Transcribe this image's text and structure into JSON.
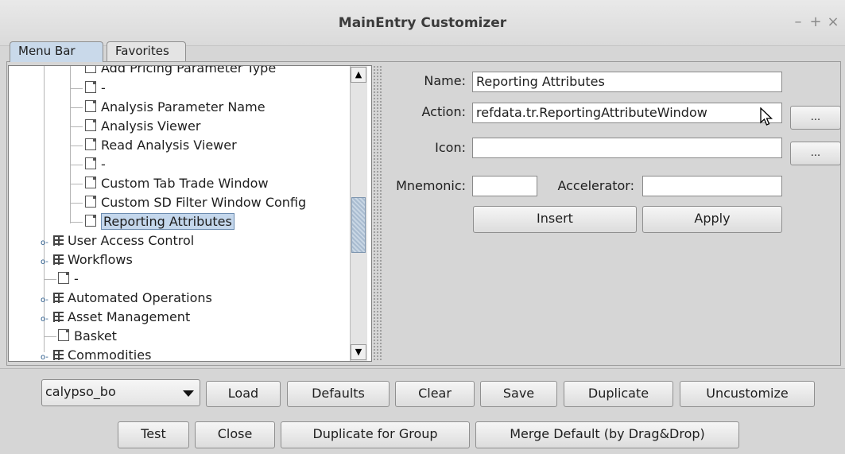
{
  "window": {
    "title": "MainEntry Customizer",
    "controls": {
      "minimize": "–",
      "maximize": "+",
      "close": "×"
    }
  },
  "tabs": [
    {
      "label": "Menu Bar",
      "active": true
    },
    {
      "label": "Favorites",
      "active": false
    }
  ],
  "tree": {
    "items": [
      {
        "label": "Add Pricing Parameter Type",
        "type": "leaf",
        "level": 2
      },
      {
        "label": "-",
        "type": "leaf",
        "level": 2
      },
      {
        "label": "Analysis Parameter Name",
        "type": "leaf",
        "level": 2
      },
      {
        "label": "Analysis Viewer",
        "type": "leaf",
        "level": 2
      },
      {
        "label": "Read Analysis Viewer",
        "type": "leaf",
        "level": 2
      },
      {
        "label": "-",
        "type": "leaf",
        "level": 2
      },
      {
        "label": "Custom Tab Trade Window",
        "type": "leaf",
        "level": 2
      },
      {
        "label": "Custom SD Filter Window Config",
        "type": "leaf",
        "level": 2
      },
      {
        "label": "Reporting Attributes",
        "type": "leaf",
        "level": 2,
        "selected": true
      },
      {
        "label": "User Access Control",
        "type": "folder",
        "level": 1
      },
      {
        "label": "Workflows",
        "type": "folder",
        "level": 1
      },
      {
        "label": "-",
        "type": "leaf",
        "level": 1
      },
      {
        "label": "Automated Operations",
        "type": "folder",
        "level": 1
      },
      {
        "label": "Asset Management",
        "type": "folder",
        "level": 1
      },
      {
        "label": "Basket",
        "type": "leaf",
        "level": 1
      },
      {
        "label": "Commodities",
        "type": "folder",
        "level": 1
      }
    ],
    "scroll_up": "▲",
    "scroll_down": "▼"
  },
  "form": {
    "name_label": "Name:",
    "name_value": "Reporting Attributes",
    "action_label": "Action:",
    "action_value": "refdata.tr.ReportingAttributeWindow",
    "icon_label": "Icon:",
    "icon_value": "",
    "browse_label": "...",
    "mnemonic_label": "Mnemonic:",
    "mnemonic_value": "",
    "accelerator_label": "Accelerator:",
    "accelerator_value": "",
    "insert_label": "Insert",
    "apply_label": "Apply"
  },
  "bottom": {
    "group_select": "calypso_bo",
    "row1": [
      "Load",
      "Defaults",
      "Clear",
      "Save",
      "Duplicate",
      "Uncustomize"
    ],
    "row2": [
      "Test",
      "Close",
      "Duplicate for Group",
      "Merge Default (by Drag&Drop)"
    ]
  }
}
